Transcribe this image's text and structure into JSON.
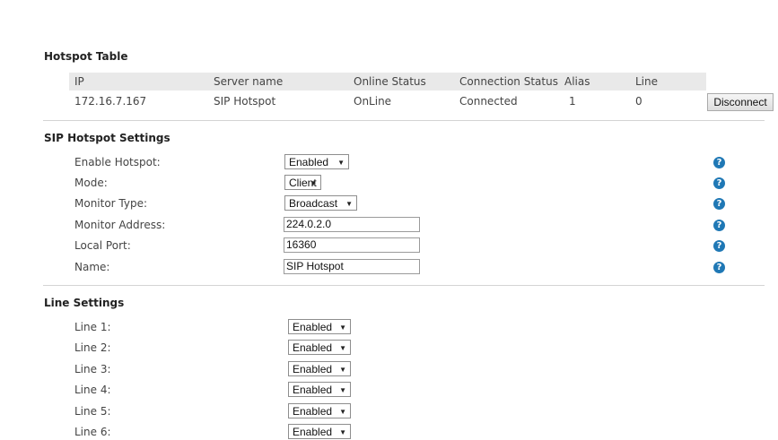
{
  "hotspot_table": {
    "title": "Hotspot Table",
    "columns": [
      "IP",
      "Server name",
      "Online Status",
      "Connection Status",
      "Alias",
      "Line"
    ],
    "row": {
      "ip": "172.16.7.167",
      "server_name": "SIP Hotspot",
      "online_status": "OnLine",
      "connection_status": "Connected",
      "alias": "1",
      "line": "0"
    },
    "disconnect_label": "Disconnect"
  },
  "sip_settings": {
    "title": "SIP Hotspot Settings",
    "enable_hotspot": {
      "label": "Enable Hotspot:",
      "value": "Enabled"
    },
    "mode": {
      "label": "Mode:",
      "value": "Client"
    },
    "monitor_type": {
      "label": "Monitor Type:",
      "value": "Broadcast"
    },
    "monitor_address": {
      "label": "Monitor Address:",
      "value": "224.0.2.0"
    },
    "local_port": {
      "label": "Local Port:",
      "value": "16360"
    },
    "name": {
      "label": "Name:",
      "value": "SIP Hotspot"
    },
    "help_glyph": "?"
  },
  "line_settings": {
    "title": "Line Settings",
    "lines": [
      {
        "label": "Line 1:",
        "value": "Enabled"
      },
      {
        "label": "Line 2:",
        "value": "Enabled"
      },
      {
        "label": "Line 3:",
        "value": "Enabled"
      },
      {
        "label": "Line 4:",
        "value": "Enabled"
      },
      {
        "label": "Line 5:",
        "value": "Enabled"
      },
      {
        "label": "Line 6:",
        "value": "Enabled"
      }
    ]
  },
  "dropdown_arrow": "▼",
  "colors": {
    "help_icon": "#1f78b5",
    "header_bg": "#e9e9e9",
    "divider": "#d4d4d4"
  }
}
